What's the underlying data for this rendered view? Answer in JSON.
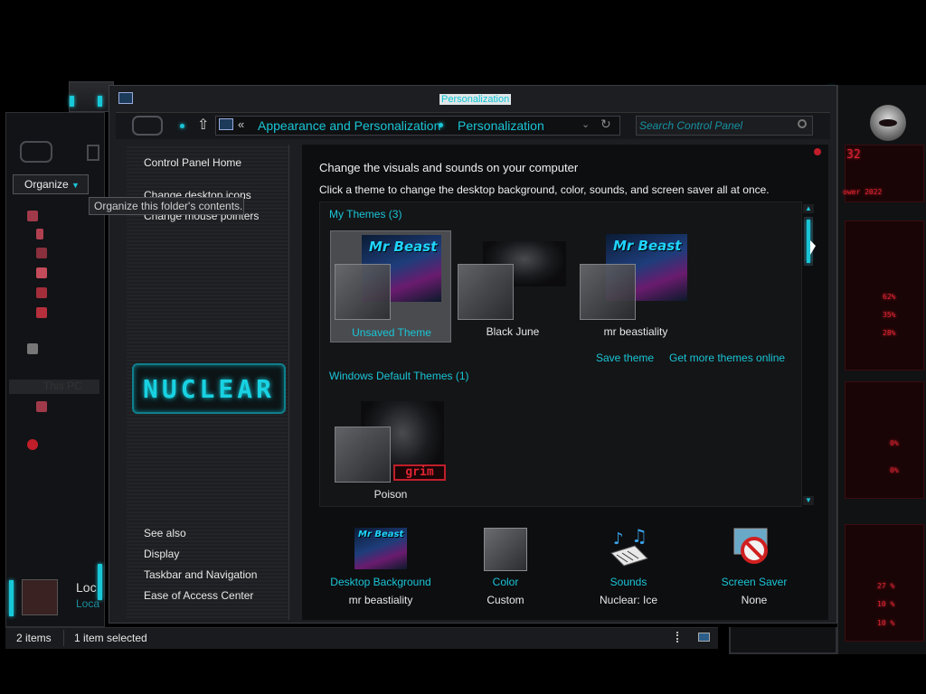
{
  "window": {
    "title": "Personalization"
  },
  "address_bar": {
    "chevron": "«",
    "crumbs": [
      "Appearance and Personalization",
      "Personalization"
    ],
    "search_placeholder": "Search Control Panel"
  },
  "background_window": {
    "organize_label": "Organize",
    "tooltip": "Organize this folder's contents.",
    "this_pc": "This PC",
    "loc_line1": "Loc",
    "loc_line2": "Loca"
  },
  "left_panel": {
    "home_link": "Control Panel Home",
    "links": [
      "Change desktop icons",
      "Change mouse pointers"
    ],
    "logo_text": "NUCLEAR",
    "see_also_heading": "See also",
    "see_also": [
      "Display",
      "Taskbar and Navigation",
      "Ease of Access Center"
    ]
  },
  "content": {
    "heading": "Change the visuals and sounds on your computer",
    "subheading": "Click a theme to change the desktop background, color, sounds, and screen saver all at once.",
    "my_themes_label": "My Themes (3)",
    "my_themes": [
      {
        "name": "Unsaved Theme",
        "selected": true,
        "art": "mr-beast",
        "art_text": "Mr Beast"
      },
      {
        "name": "Black June",
        "selected": false,
        "art": "black-june"
      },
      {
        "name": "mr beastiality",
        "selected": false,
        "art": "mr-beast",
        "art_text": "Mr Beast"
      }
    ],
    "save_theme_link": "Save theme",
    "get_more_link": "Get more themes online",
    "default_themes_label": "Windows Default Themes (1)",
    "default_themes": [
      {
        "name": "Poison",
        "art": "grim",
        "badge": "grim"
      }
    ]
  },
  "bottom": [
    {
      "label": "Desktop Background",
      "value": "mr beastiality",
      "icon": "desktop-background-icon"
    },
    {
      "label": "Color",
      "value": "Custom",
      "icon": "color-swatch-icon"
    },
    {
      "label": "Sounds",
      "value": "Nuclear: Ice",
      "icon": "sounds-icon"
    },
    {
      "label": "Screen Saver",
      "value": "None",
      "icon": "screen-saver-icon"
    }
  ],
  "status_bar": {
    "item_count": "2 items",
    "selected": "1 item selected"
  },
  "colors": {
    "accent_cyan": "#19c5d6",
    "gadget_red": "#e12432",
    "background": "#000000"
  },
  "gadget": {
    "values": [
      "32",
      "ower 2022",
      "62%",
      "35%",
      "28%",
      "0%",
      "0%",
      "27 %",
      "10 %",
      "10 %"
    ]
  }
}
